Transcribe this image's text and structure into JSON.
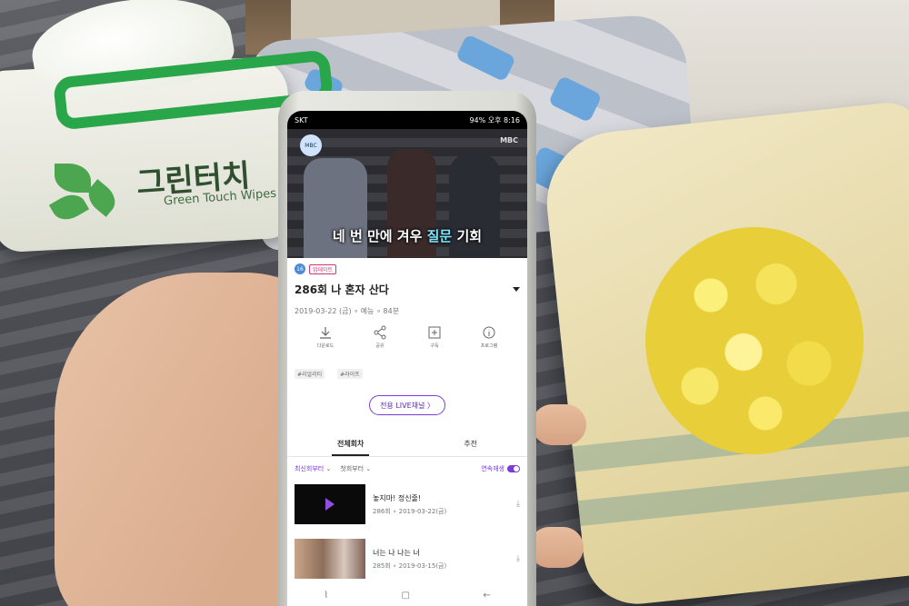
{
  "scene": {
    "wipes_brand": "그린터치",
    "wipes_sub": "Green Touch Wipes"
  },
  "phone": {
    "status_bar": {
      "carrier": "SKT",
      "battery": "94%",
      "time": "오후 8:16"
    },
    "video": {
      "broadcaster": "MBC",
      "caption_part1": "네 번 만에 겨우 ",
      "caption_highlight": "질문",
      "caption_part2": " 기회"
    },
    "program": {
      "update_badge": "업데이트",
      "episode_title": "286회 나 혼자 산다",
      "meta": "2019-03-22 (금) ∘ 예능 ∘ 84분"
    },
    "actions": [
      {
        "label": "다운로드",
        "icon": "download-icon"
      },
      {
        "label": "공유",
        "icon": "share-icon"
      },
      {
        "label": "구독",
        "icon": "plus-box-icon"
      },
      {
        "label": "프로그램",
        "icon": "info-icon"
      }
    ],
    "tags": [
      "#리얼리티",
      "#라이프"
    ],
    "live_button": "전용 LIVE채널 〉",
    "tabs": [
      "전체회차",
      "추천"
    ],
    "filters": {
      "sort": "최신회부터 ⌄",
      "start": "첫회부터 ⌄",
      "autoplay": "연속재생"
    },
    "episodes": [
      {
        "name": "놓지마! 정신줄!",
        "date": "286회 ∘ 2019-03-22(금)"
      },
      {
        "name": "너는 나 나는 너",
        "date": "285회 ∘ 2019-03-15(금)"
      }
    ],
    "navbar": {
      "recent": "⌇",
      "home": "▢",
      "back": "←"
    }
  }
}
